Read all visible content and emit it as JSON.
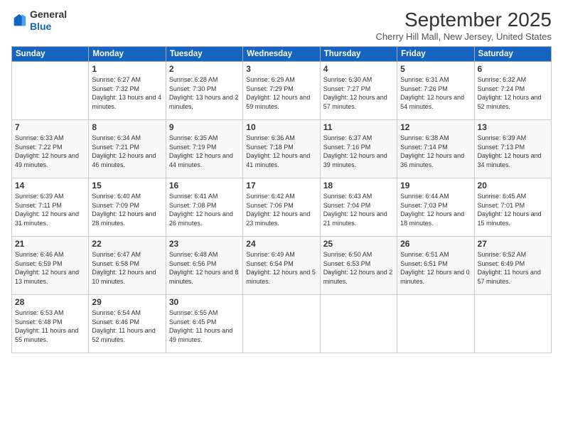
{
  "logo": {
    "text1": "General",
    "text2": "Blue"
  },
  "title": "September 2025",
  "location": "Cherry Hill Mall, New Jersey, United States",
  "headers": [
    "Sunday",
    "Monday",
    "Tuesday",
    "Wednesday",
    "Thursday",
    "Friday",
    "Saturday"
  ],
  "weeks": [
    [
      {
        "day": "",
        "sunrise": "",
        "sunset": "",
        "daylight": ""
      },
      {
        "day": "1",
        "sunrise": "Sunrise: 6:27 AM",
        "sunset": "Sunset: 7:32 PM",
        "daylight": "Daylight: 13 hours and 4 minutes."
      },
      {
        "day": "2",
        "sunrise": "Sunrise: 6:28 AM",
        "sunset": "Sunset: 7:30 PM",
        "daylight": "Daylight: 13 hours and 2 minutes."
      },
      {
        "day": "3",
        "sunrise": "Sunrise: 6:29 AM",
        "sunset": "Sunset: 7:29 PM",
        "daylight": "Daylight: 12 hours and 59 minutes."
      },
      {
        "day": "4",
        "sunrise": "Sunrise: 6:30 AM",
        "sunset": "Sunset: 7:27 PM",
        "daylight": "Daylight: 12 hours and 57 minutes."
      },
      {
        "day": "5",
        "sunrise": "Sunrise: 6:31 AM",
        "sunset": "Sunset: 7:26 PM",
        "daylight": "Daylight: 12 hours and 54 minutes."
      },
      {
        "day": "6",
        "sunrise": "Sunrise: 6:32 AM",
        "sunset": "Sunset: 7:24 PM",
        "daylight": "Daylight: 12 hours and 52 minutes."
      }
    ],
    [
      {
        "day": "7",
        "sunrise": "Sunrise: 6:33 AM",
        "sunset": "Sunset: 7:22 PM",
        "daylight": "Daylight: 12 hours and 49 minutes."
      },
      {
        "day": "8",
        "sunrise": "Sunrise: 6:34 AM",
        "sunset": "Sunset: 7:21 PM",
        "daylight": "Daylight: 12 hours and 46 minutes."
      },
      {
        "day": "9",
        "sunrise": "Sunrise: 6:35 AM",
        "sunset": "Sunset: 7:19 PM",
        "daylight": "Daylight: 12 hours and 44 minutes."
      },
      {
        "day": "10",
        "sunrise": "Sunrise: 6:36 AM",
        "sunset": "Sunset: 7:18 PM",
        "daylight": "Daylight: 12 hours and 41 minutes."
      },
      {
        "day": "11",
        "sunrise": "Sunrise: 6:37 AM",
        "sunset": "Sunset: 7:16 PM",
        "daylight": "Daylight: 12 hours and 39 minutes."
      },
      {
        "day": "12",
        "sunrise": "Sunrise: 6:38 AM",
        "sunset": "Sunset: 7:14 PM",
        "daylight": "Daylight: 12 hours and 36 minutes."
      },
      {
        "day": "13",
        "sunrise": "Sunrise: 6:39 AM",
        "sunset": "Sunset: 7:13 PM",
        "daylight": "Daylight: 12 hours and 34 minutes."
      }
    ],
    [
      {
        "day": "14",
        "sunrise": "Sunrise: 6:39 AM",
        "sunset": "Sunset: 7:11 PM",
        "daylight": "Daylight: 12 hours and 31 minutes."
      },
      {
        "day": "15",
        "sunrise": "Sunrise: 6:40 AM",
        "sunset": "Sunset: 7:09 PM",
        "daylight": "Daylight: 12 hours and 28 minutes."
      },
      {
        "day": "16",
        "sunrise": "Sunrise: 6:41 AM",
        "sunset": "Sunset: 7:08 PM",
        "daylight": "Daylight: 12 hours and 26 minutes."
      },
      {
        "day": "17",
        "sunrise": "Sunrise: 6:42 AM",
        "sunset": "Sunset: 7:06 PM",
        "daylight": "Daylight: 12 hours and 23 minutes."
      },
      {
        "day": "18",
        "sunrise": "Sunrise: 6:43 AM",
        "sunset": "Sunset: 7:04 PM",
        "daylight": "Daylight: 12 hours and 21 minutes."
      },
      {
        "day": "19",
        "sunrise": "Sunrise: 6:44 AM",
        "sunset": "Sunset: 7:03 PM",
        "daylight": "Daylight: 12 hours and 18 minutes."
      },
      {
        "day": "20",
        "sunrise": "Sunrise: 6:45 AM",
        "sunset": "Sunset: 7:01 PM",
        "daylight": "Daylight: 12 hours and 15 minutes."
      }
    ],
    [
      {
        "day": "21",
        "sunrise": "Sunrise: 6:46 AM",
        "sunset": "Sunset: 6:59 PM",
        "daylight": "Daylight: 12 hours and 13 minutes."
      },
      {
        "day": "22",
        "sunrise": "Sunrise: 6:47 AM",
        "sunset": "Sunset: 6:58 PM",
        "daylight": "Daylight: 12 hours and 10 minutes."
      },
      {
        "day": "23",
        "sunrise": "Sunrise: 6:48 AM",
        "sunset": "Sunset: 6:56 PM",
        "daylight": "Daylight: 12 hours and 8 minutes."
      },
      {
        "day": "24",
        "sunrise": "Sunrise: 6:49 AM",
        "sunset": "Sunset: 6:54 PM",
        "daylight": "Daylight: 12 hours and 5 minutes."
      },
      {
        "day": "25",
        "sunrise": "Sunrise: 6:50 AM",
        "sunset": "Sunset: 6:53 PM",
        "daylight": "Daylight: 12 hours and 2 minutes."
      },
      {
        "day": "26",
        "sunrise": "Sunrise: 6:51 AM",
        "sunset": "Sunset: 6:51 PM",
        "daylight": "Daylight: 12 hours and 0 minutes."
      },
      {
        "day": "27",
        "sunrise": "Sunrise: 6:52 AM",
        "sunset": "Sunset: 6:49 PM",
        "daylight": "Daylight: 11 hours and 57 minutes."
      }
    ],
    [
      {
        "day": "28",
        "sunrise": "Sunrise: 6:53 AM",
        "sunset": "Sunset: 6:48 PM",
        "daylight": "Daylight: 11 hours and 55 minutes."
      },
      {
        "day": "29",
        "sunrise": "Sunrise: 6:54 AM",
        "sunset": "Sunset: 6:46 PM",
        "daylight": "Daylight: 11 hours and 52 minutes."
      },
      {
        "day": "30",
        "sunrise": "Sunrise: 6:55 AM",
        "sunset": "Sunset: 6:45 PM",
        "daylight": "Daylight: 11 hours and 49 minutes."
      },
      {
        "day": "",
        "sunrise": "",
        "sunset": "",
        "daylight": ""
      },
      {
        "day": "",
        "sunrise": "",
        "sunset": "",
        "daylight": ""
      },
      {
        "day": "",
        "sunrise": "",
        "sunset": "",
        "daylight": ""
      },
      {
        "day": "",
        "sunrise": "",
        "sunset": "",
        "daylight": ""
      }
    ]
  ]
}
